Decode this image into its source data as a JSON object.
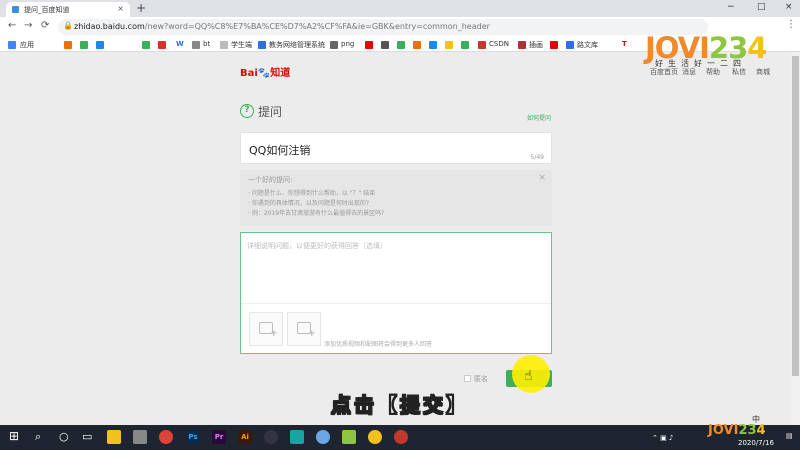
{
  "browser": {
    "tab_title": "提问_百度知道",
    "tab_close": "×",
    "new_tab": "+",
    "window_controls": [
      "−",
      "□",
      "×"
    ],
    "nav_icons": [
      "←",
      "→",
      "⟳"
    ],
    "url_host": "zhidao.baidu.com",
    "url_path": "/new?word=QQ%C8%E7%BA%CE%D7%A2%CF%FA&ie=GBK&entry=common_header",
    "menu_icon": "⋮"
  },
  "bookmarks": [
    {
      "label": "应用",
      "color": "#4285f4"
    },
    {
      "label": "",
      "color": "#e8710a"
    },
    {
      "label": "",
      "color": "#3dae5a"
    },
    {
      "label": "",
      "color": "#1e88e5"
    },
    {
      "label": "",
      "color": "#d93025"
    },
    {
      "label": "bt",
      "color": "#888888"
    },
    {
      "label": "学生端",
      "color": "#555555"
    },
    {
      "label": "教务网络管理系统",
      "color": "#2d6ee0"
    },
    {
      "label": "png",
      "color": "#666666"
    },
    {
      "label": "CSDN",
      "color": "#c0392b"
    },
    {
      "label": "插画",
      "color": "#aa3333"
    },
    {
      "label": "路文库",
      "color": "#2d6ee0"
    }
  ],
  "site": {
    "logo_bai": "Bai",
    "logo_paw": "du",
    "logo_zhidao": "知道",
    "top_nav": [
      "百度首页",
      "消息",
      "帮助",
      "私信",
      "商城"
    ],
    "watermark": [
      "JOVI",
      "23",
      "4"
    ],
    "watermark_slogan": "好生活好一二四"
  },
  "ask": {
    "icon_glyph": "?",
    "title": "提问",
    "how_to_ask": "如何提问",
    "question_value": "QQ如何注销",
    "question_count": "5/49",
    "tips_title": "一个好的提问:",
    "tips": [
      "· 问题是什么、你想得到什么帮助，以 \"？\" 结束",
      "· 你遇到的具体情况，以及问题是何时出现的?",
      "· 例：2019年去甘肃旅游有什么最值得去的景区吗?"
    ],
    "tips_close": "×",
    "detail_placeholder": "详细说明问题，以便更好的获得回答（选填）",
    "media_hint": "添加优质视频和配图将会得到更多人回答",
    "anonymous_label": "匿名"
  },
  "caption": "点击【提交】",
  "ime": "中",
  "taskbar": {
    "start_icon": "windows-logo",
    "tray_date": "2020/7/16"
  }
}
